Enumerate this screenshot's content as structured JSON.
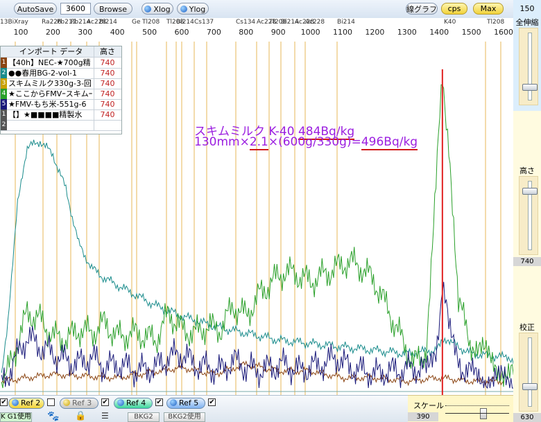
{
  "toolbar": {
    "autosave_label": "AutoSave",
    "time_value": "3600",
    "browse_label": "Browse",
    "xlog_label": "Xlog",
    "ylog_label": "Ylog",
    "line_graph_label": "線グラフ",
    "cps_label": "cps",
    "max_label": "Max"
  },
  "axis": {
    "ticks": [
      "100",
      "200",
      "300",
      "400",
      "500",
      "600",
      "700",
      "800",
      "900",
      "1000",
      "1100",
      "1200",
      "1300",
      "1400",
      "1500",
      "1600"
    ],
    "isotopes": [
      "13BiXray",
      "Ra226",
      "Pb212",
      "Pb214",
      "Ac228",
      "Bi214",
      "Ge",
      "Tl208",
      "Tl208",
      "Bi214",
      "Cs137",
      "Cs134",
      "Ac228",
      "Tl208",
      "Bi214",
      "Ac228",
      "Ac228",
      "Bi214",
      "K40",
      "Tl208"
    ]
  },
  "legend": {
    "header_name": "インポート データ",
    "header_value": "高さ",
    "rows": [
      {
        "num": "1",
        "name": "【40h】NEC-★700g精",
        "value": "740",
        "color": "#8b4513"
      },
      {
        "num": "2",
        "name": "●●春用BG-2-vol-1",
        "value": "740",
        "color": "#1a8c8c"
      },
      {
        "num": "3",
        "name": "スキムミルク330g-3-回",
        "value": "740",
        "color": "#c8a000"
      },
      {
        "num": "4",
        "name": "★ここからFMVｰスキムｰ",
        "value": "740",
        "color": "#2aa02a"
      },
      {
        "num": "5",
        "name": "★FMV-もち米-551g-6",
        "value": "740",
        "color": "#1a1a7a"
      },
      {
        "num": "1",
        "name": "【】★■■■■精製水",
        "value": "740",
        "color": "#555555"
      },
      {
        "num": "2",
        "name": "",
        "value": "",
        "color": "#555555"
      }
    ]
  },
  "annotation": {
    "line1_prefix": "スキムミルク  K-40  ",
    "line1_value": "484Bq/kg",
    "line2_prefix": "130mm×",
    "line2_factor": "2.1",
    "line2_middle": "×(600g/330g)=",
    "line2_value": "496Bq/kg"
  },
  "right_panel": {
    "top_value": "150",
    "full_label": "全伸縮",
    "height_label": "高さ",
    "height_value": "740",
    "calib_label": "校正",
    "calib_value": "630"
  },
  "bottom": {
    "ref2_label": "Ref 2",
    "ref3_label": "Ref 3",
    "ref4_label": "Ref 4",
    "ref5_label": "Ref 5",
    "bkg1_label": "K G1使用",
    "bkg2_label": "BKG2",
    "bkg2use_label": "BKG2使用",
    "scale_label": "スケール",
    "scale_value": "390"
  },
  "colors": {
    "accent_red": "#e02020",
    "annotation_purple": "#9b1ee0",
    "underline_red": "#d01818",
    "grid_orange": "#e0a020"
  },
  "chart_data": {
    "type": "line",
    "xlim": [
      0,
      1650
    ],
    "xticks": [
      100,
      200,
      300,
      400,
      500,
      600,
      700,
      800,
      900,
      1000,
      1100,
      1200,
      1300,
      1400,
      1500,
      1600
    ],
    "xlabel": "",
    "ylabel": "",
    "marker_line_x": 1410,
    "series": [
      {
        "name": "【40h】NEC-★700g精",
        "color": "#8b4513",
        "x": [
          40,
          200,
          400,
          600,
          700,
          800,
          900,
          1000,
          1100,
          1200,
          1300,
          1400,
          1500,
          1600
        ],
        "y": [
          2,
          4,
          3,
          6,
          4,
          7,
          5,
          5,
          3,
          3,
          2,
          3,
          2,
          2
        ]
      },
      {
        "name": "●●春用BG-2-vol-1",
        "color": "#1a8c8c",
        "x": [
          40,
          60,
          90,
          120,
          160,
          200,
          240,
          280,
          320,
          360,
          400,
          460,
          520,
          600,
          700,
          800,
          900,
          1000,
          1100,
          1200,
          1300,
          1380,
          1410,
          1440,
          1500,
          1600,
          1650
        ],
        "y": [
          3,
          20,
          55,
          70,
          72,
          68,
          58,
          42,
          35,
          32,
          30,
          27,
          24,
          21,
          18,
          16,
          14,
          13,
          12,
          11,
          10,
          11,
          14,
          13,
          10,
          9,
          8
        ]
      },
      {
        "name": "★ここからFMVｰスキムｰ",
        "color": "#2aa02a",
        "x": [
          40,
          60,
          80,
          120,
          160,
          200,
          240,
          280,
          320,
          360,
          400,
          460,
          520,
          560,
          600,
          640,
          680,
          720,
          760,
          800,
          840,
          880,
          920,
          960,
          1000,
          1040,
          1080,
          1120,
          1160,
          1200,
          1240,
          1280,
          1320,
          1360,
          1390,
          1410,
          1430,
          1460,
          1500,
          1550,
          1600,
          1650
        ],
        "y": [
          2,
          5,
          10,
          22,
          20,
          15,
          14,
          17,
          16,
          19,
          15,
          16,
          14,
          22,
          17,
          16,
          18,
          17,
          24,
          21,
          27,
          31,
          34,
          33,
          31,
          33,
          35,
          37,
          35,
          31,
          23,
          15,
          7,
          11,
          60,
          90,
          72,
          25,
          13,
          9,
          5,
          3
        ]
      },
      {
        "name": "★FMV-もち米-551g-6",
        "color": "#1a1a7a",
        "x": [
          40,
          60,
          80,
          120,
          160,
          200,
          240,
          280,
          320,
          360,
          400,
          460,
          520,
          560,
          600,
          640,
          680,
          720,
          760,
          800,
          840,
          880,
          920,
          960,
          1000,
          1040,
          1080,
          1120,
          1160,
          1200,
          1240,
          1280,
          1320,
          1360,
          1390,
          1410,
          1430,
          1460,
          1500,
          1550,
          1600,
          1650
        ],
        "y": [
          1,
          4,
          8,
          15,
          12,
          10,
          8,
          7,
          9,
          6,
          7,
          5,
          6,
          9,
          10,
          7,
          6,
          5,
          8,
          6,
          5,
          6,
          7,
          5,
          6,
          7,
          9,
          6,
          5,
          4,
          5,
          5,
          6,
          5,
          10,
          31,
          17,
          7,
          4,
          3,
          2,
          1
        ]
      }
    ]
  }
}
